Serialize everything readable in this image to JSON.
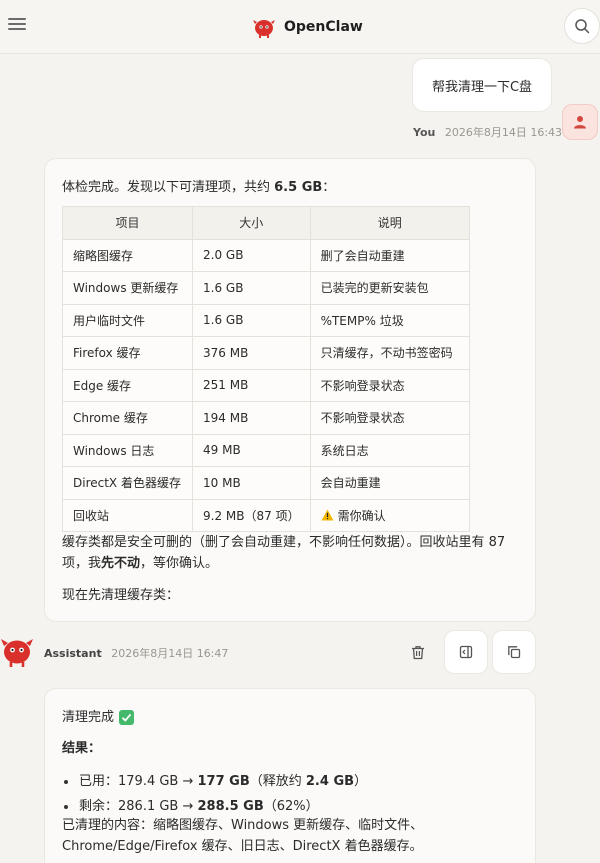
{
  "header": {
    "title": "OpenClaw"
  },
  "user_message": {
    "text": "帮我清理一下C盘",
    "author": "You",
    "timestamp": "2026年8月14日 16:43"
  },
  "assistant_message_1": {
    "intro_prefix": "体检完成。发现以下可清理项，共约 ",
    "intro_total": "6.5 GB",
    "intro_suffix": "：",
    "table": {
      "headers": [
        "项目",
        "大小",
        "说明"
      ],
      "rows": [
        [
          "缩略图缓存",
          "2.0 GB",
          "删了会自动重建"
        ],
        [
          "Windows 更新缓存",
          "1.6 GB",
          "已装完的更新安装包"
        ],
        [
          "用户临时文件",
          "1.6 GB",
          "%TEMP% 垃圾"
        ],
        [
          "Firefox 缓存",
          "376 MB",
          "只清缓存，不动书签密码"
        ],
        [
          "Edge 缓存",
          "251 MB",
          "不影响登录状态"
        ],
        [
          "Chrome 缓存",
          "194 MB",
          "不影响登录状态"
        ],
        [
          "Windows 日志",
          "49 MB",
          "系统日志"
        ],
        [
          "DirectX 着色器缓存",
          "10 MB",
          "会自动重建"
        ],
        [
          "回收站",
          "9.2 MB（87 项）",
          "需你确认"
        ]
      ]
    },
    "note_prefix": "缓存类都是安全可删的（删了会自动重建，不影响任何数据）。回收站里有 87 项，我",
    "note_bold": "先不动",
    "note_suffix": "，等你确认。",
    "last_line": "现在先清理缓存类："
  },
  "assistant_meta": {
    "author": "Assistant",
    "timestamp": "2026年8月14日 16:47"
  },
  "assistant_message_2": {
    "title": "清理完成",
    "result_label": "结果：",
    "used_prefix": "已用：179.4 GB → ",
    "used_bold": "177 GB",
    "used_mid": "（释放约 ",
    "used_freed": "2.4 GB",
    "used_suffix": "）",
    "free_prefix": "剩余：286.1 GB → ",
    "free_bold": "288.5 GB",
    "free_suffix": "（62%）",
    "cleared": "已清理的内容：缩略图缓存、Windows 更新缓存、临时文件、Chrome/Edge/Firefox 缓存、旧日志、DirectX 着色器缓存。"
  },
  "colors": {
    "background": "#f5f3ef",
    "card": "#fbfaf8",
    "brand_red": "#d9302c",
    "check_green": "#44b96b"
  },
  "icons": {
    "menu": "hamburger-icon",
    "search": "search-icon",
    "user": "user-icon",
    "delete": "trash-icon",
    "panel": "side-panel-icon",
    "copy": "copy-icon",
    "warning": "warning-icon",
    "check": "check-icon"
  }
}
